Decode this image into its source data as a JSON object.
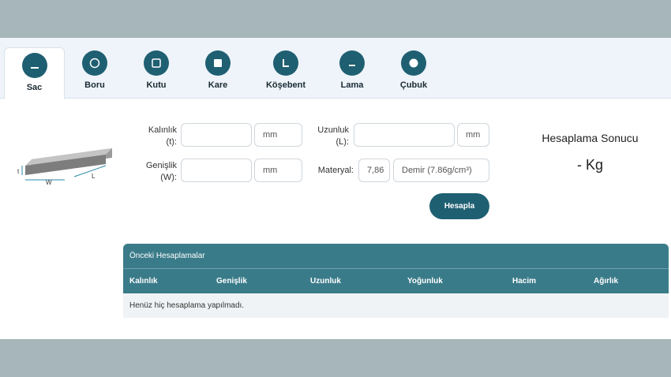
{
  "tabs": [
    {
      "label": "Sac",
      "icon": "sheet-icon",
      "active": true
    },
    {
      "label": "Boru",
      "icon": "pipe-icon",
      "active": false
    },
    {
      "label": "Kutu",
      "icon": "box-icon",
      "active": false
    },
    {
      "label": "Kare",
      "icon": "square-bar-icon",
      "active": false
    },
    {
      "label": "Köşebent",
      "icon": "angle-icon",
      "active": false
    },
    {
      "label": "Lama",
      "icon": "flat-bar-icon",
      "active": false
    },
    {
      "label": "Çubuk",
      "icon": "round-bar-icon",
      "active": false
    }
  ],
  "diagram": {
    "w": "W",
    "l": "L",
    "t": "t"
  },
  "form": {
    "thickness_label_1": "Kalınlık",
    "thickness_label_2": "(t):",
    "thickness_value": "",
    "thickness_unit": "mm",
    "width_label_1": "Genişlik",
    "width_label_2": "(W):",
    "width_value": "",
    "width_unit": "mm",
    "length_label_1": "Uzunluk",
    "length_label_2": "(L):",
    "length_value": "",
    "length_unit": "mm",
    "material_label": "Materyal:",
    "density_value": "7,86",
    "material_select": "Demir (7.86g/cm³)",
    "calculate_label": "Hesapla"
  },
  "result": {
    "title": "Hesaplama Sonucu",
    "value": "- Kg"
  },
  "history": {
    "title": "Önceki Hesaplamalar",
    "columns": [
      "Kalınlık",
      "Genişlik",
      "Uzunluk",
      "Yoğunluk",
      "Hacim",
      "Ağırlık"
    ],
    "empty_text": "Henüz hiç hesaplama yapılmadı."
  },
  "colors": {
    "primary": "#1f5f72",
    "table_header": "#3a7b89",
    "background": "#a6b6ba"
  }
}
